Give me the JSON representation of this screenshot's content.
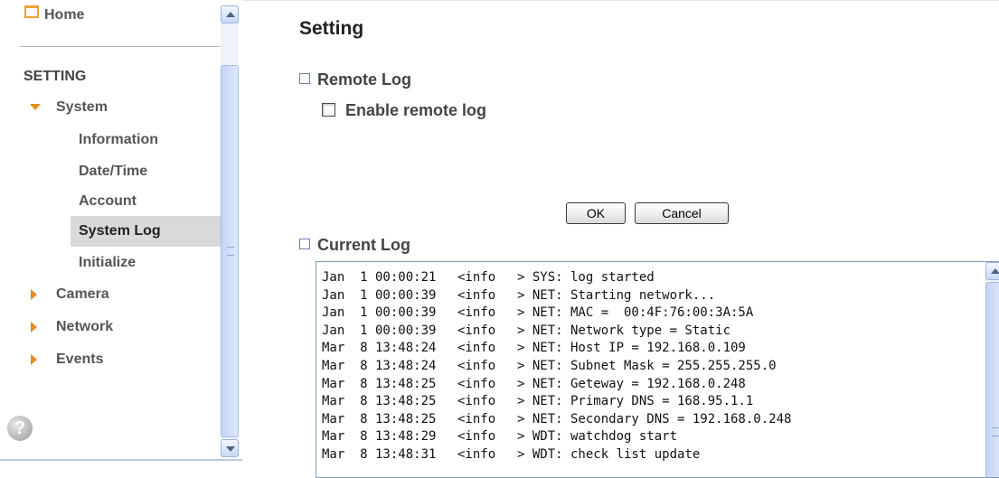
{
  "sidebar": {
    "home_label": "Home",
    "section_header": "SETTING",
    "system": {
      "label": "System",
      "children": [
        "Information",
        "Date/Time",
        "Account",
        "System Log",
        "Initialize"
      ],
      "active": "System Log"
    },
    "other_items": [
      "Camera",
      "Network",
      "Events"
    ],
    "help_glyph": "?"
  },
  "main": {
    "title": "Setting",
    "remote_log": {
      "title": "Remote Log",
      "enable_label": "Enable remote log",
      "enabled": false
    },
    "buttons": {
      "ok": "OK",
      "cancel": "Cancel"
    },
    "current_log": {
      "title": "Current Log",
      "entries": [
        {
          "date": "Jan  1 00:00:21",
          "level": "<info",
          "msg": "> SYS: log started"
        },
        {
          "date": "Jan  1 00:00:39",
          "level": "<info",
          "msg": "> NET: Starting network..."
        },
        {
          "date": "Jan  1 00:00:39",
          "level": "<info",
          "msg": "> NET: MAC =  00:4F:76:00:3A:5A"
        },
        {
          "date": "Jan  1 00:00:39",
          "level": "<info",
          "msg": "> NET: Network type = Static"
        },
        {
          "date": "Mar  8 13:48:24",
          "level": "<info",
          "msg": "> NET: Host IP = 192.168.0.109"
        },
        {
          "date": "Mar  8 13:48:24",
          "level": "<info",
          "msg": "> NET: Subnet Mask = 255.255.255.0"
        },
        {
          "date": "Mar  8 13:48:25",
          "level": "<info",
          "msg": "> NET: Geteway = 192.168.0.248"
        },
        {
          "date": "Mar  8 13:48:25",
          "level": "<info",
          "msg": "> NET: Primary DNS = 168.95.1.1"
        },
        {
          "date": "Mar  8 13:48:25",
          "level": "<info",
          "msg": "> NET: Secondary DNS = 192.168.0.248"
        },
        {
          "date": "Mar  8 13:48:29",
          "level": "<info",
          "msg": "> WDT: watchdog start"
        },
        {
          "date": "Mar  8 13:48:31",
          "level": "<info",
          "msg": "> WDT: check list update"
        }
      ]
    }
  },
  "colors": {
    "accent_triangle": "#e58a1f",
    "active_item_bg": "#d9d9d9",
    "scrollbar": "#c4d4f7"
  }
}
